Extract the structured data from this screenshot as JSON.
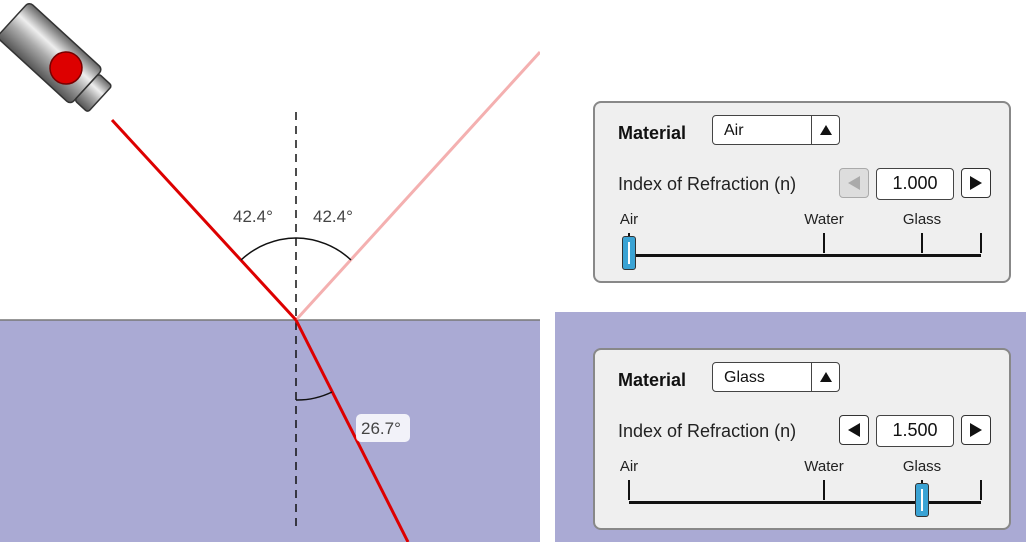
{
  "colors": {
    "medium_glass": "#aaaad4",
    "laser": "#dd0000",
    "reflected": "#f4b0b0",
    "panel_bg": "#efefef",
    "thumb": "#3aa3d4"
  },
  "simulation": {
    "reflection_angle_left": "42.4°",
    "reflection_angle_right": "42.4°",
    "refraction_angle": "26.7°",
    "laser_icon": "laser-pointer-icon"
  },
  "top_medium": {
    "material_label": "Material",
    "material_value": "Air",
    "ior_label": "Index of Refraction (n)",
    "ior_value": "1.000",
    "slider_fraction": 0.0,
    "left_button_disabled": true,
    "ticks": [
      "Air",
      "Water",
      "Glass"
    ]
  },
  "bottom_medium": {
    "material_label": "Material",
    "material_value": "Glass",
    "ior_label": "Index of Refraction (n)",
    "ior_value": "1.500",
    "slider_fraction": 0.833,
    "left_button_disabled": false,
    "ticks": [
      "Air",
      "Water",
      "Glass"
    ]
  }
}
